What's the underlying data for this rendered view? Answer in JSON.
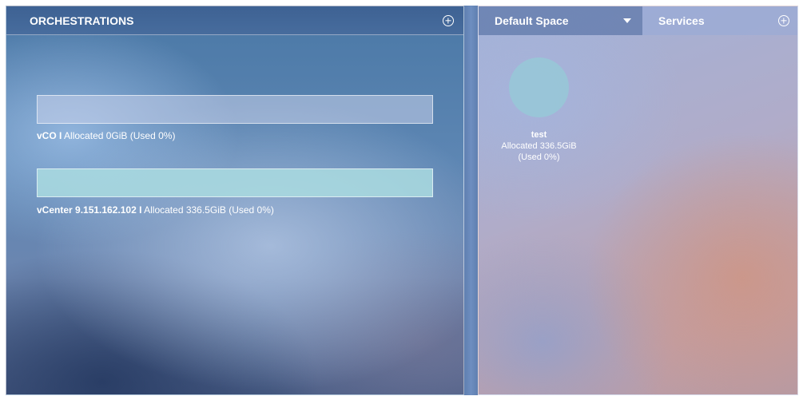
{
  "orchestrations": {
    "title": "ORCHESTRATIONS",
    "add_icon": "plus-circle-icon",
    "items": [
      {
        "name": "vCO",
        "separator": "I",
        "detail": "Allocated 0GiB (Used 0%)",
        "used_fraction": 0.0
      },
      {
        "name": "vCenter 9.151.162.102",
        "separator": "I",
        "detail": "Allocated 336.5GiB (Used 0%)",
        "used_fraction": 0.0
      }
    ]
  },
  "space": {
    "selected": "Default Space",
    "dropdown_icon": "caret-down-icon"
  },
  "services": {
    "title": "Services",
    "add_icon": "plus-circle-icon",
    "items": [
      {
        "name": "test",
        "allocated": "Allocated 336.5GiB",
        "used": "(Used 0%)"
      }
    ]
  }
}
